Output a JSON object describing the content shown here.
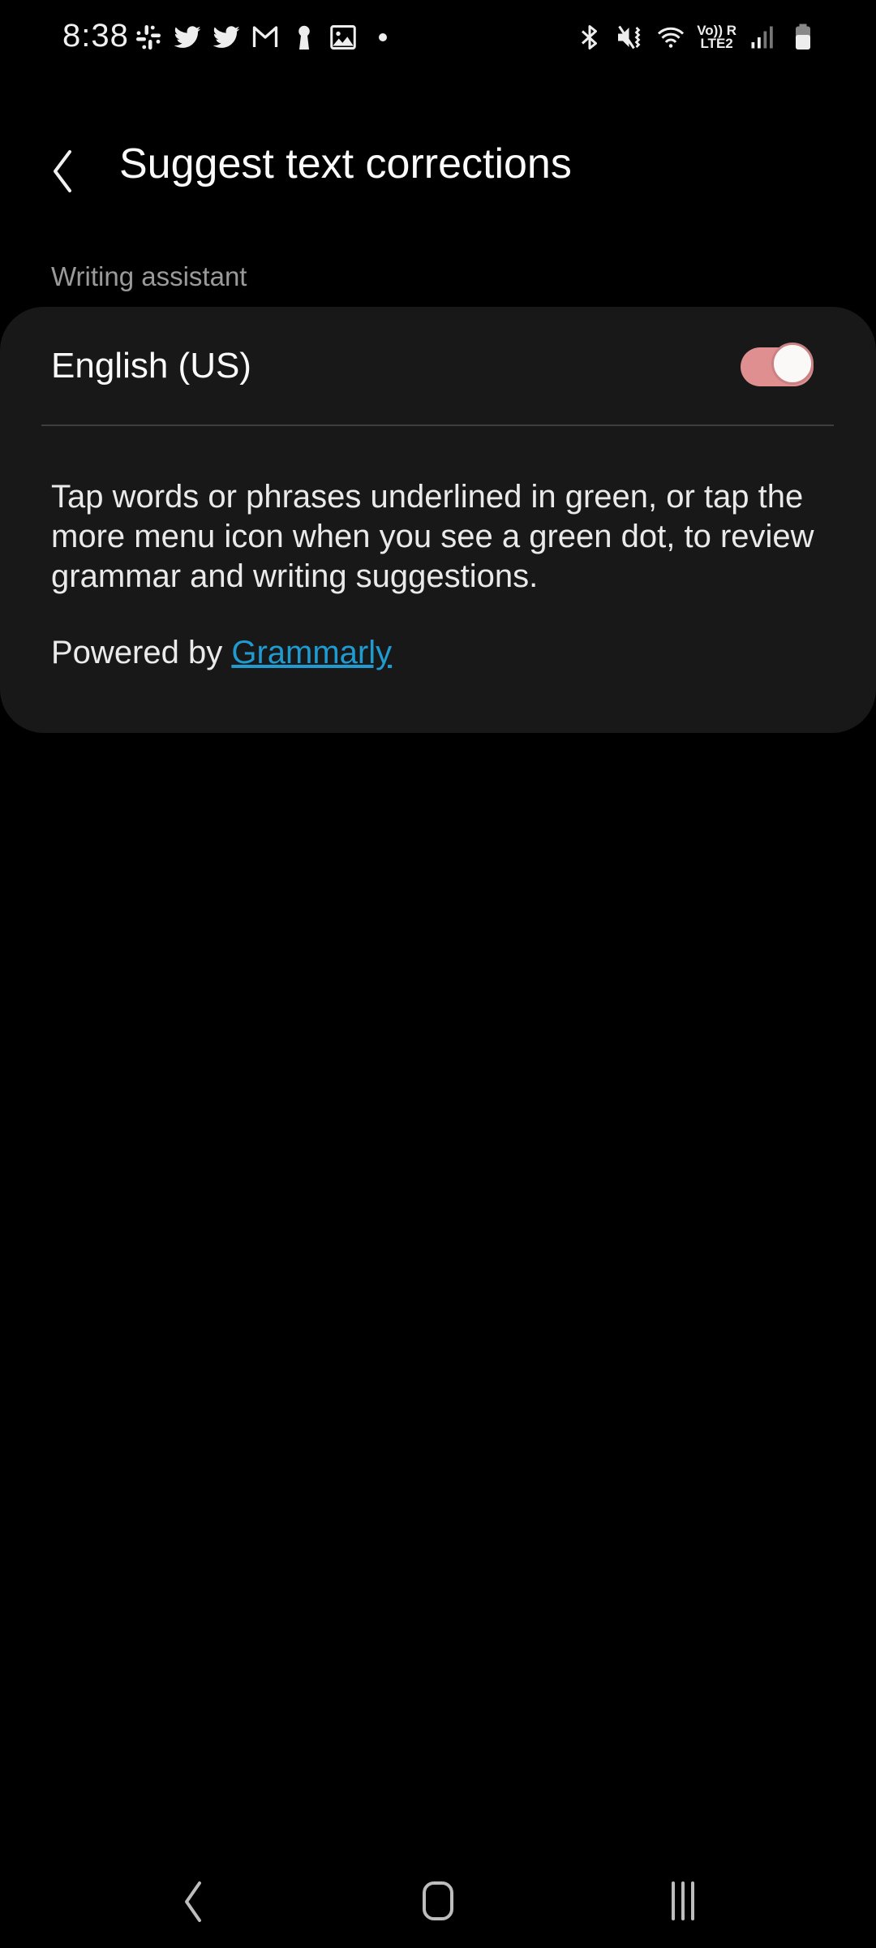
{
  "status_bar": {
    "time": "8:38",
    "notification_icons": [
      "slack-icon",
      "twitter-icon",
      "twitter-icon",
      "gmail-icon",
      "keyhole-icon",
      "gallery-icon",
      "more-dot-icon"
    ],
    "system_icons": [
      "bluetooth-icon",
      "vibrate-mute-icon",
      "wifi-icon",
      "volte-lte2-icon",
      "signal-icon",
      "battery-icon"
    ],
    "volte_label": "Vo)) R",
    "lte_label": "LTE2"
  },
  "header": {
    "title": "Suggest text corrections"
  },
  "section": {
    "label": "Writing assistant"
  },
  "card": {
    "language_label": "English (US)",
    "toggle_on": true,
    "description": "Tap words or phrases underlined in green, or tap the more menu icon when you see a green dot, to review grammar and writing suggestions.",
    "powered_by_prefix": "Powered by ",
    "powered_by_link": "Grammarly"
  },
  "colors": {
    "toggle_accent": "#e08f90",
    "link": "#1f9bd1",
    "card_bg": "#181818"
  },
  "nav_bar": {
    "buttons": [
      "back",
      "home",
      "recents"
    ]
  }
}
